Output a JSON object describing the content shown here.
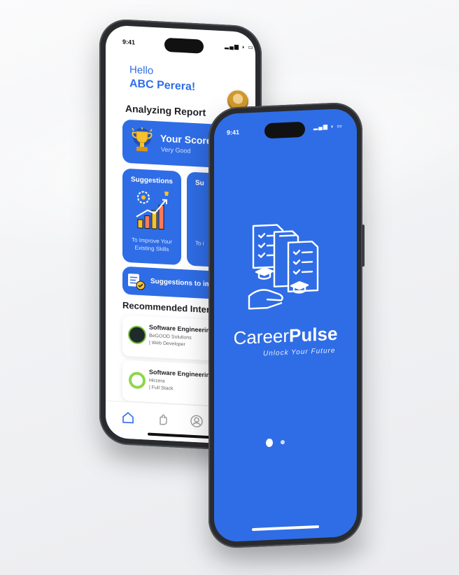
{
  "back_phone": {
    "status_time": "9:41",
    "greeting": "Hello",
    "user_name": "ABC Perera!",
    "section_analyzing": "Analyzing Report",
    "score_card": {
      "title": "Your Score is",
      "subtitle": "Very Good"
    },
    "suggestion_cards": [
      {
        "title": "Suggestions",
        "text": "To Improve Your Existing Skills"
      },
      {
        "title": "Su",
        "text": "To i"
      }
    ],
    "improve_banner": "Suggestions to imp",
    "section_recommended": "Recommended Intern",
    "internships": [
      {
        "title": "Software Engineering",
        "company": "BeGOOD Solutions",
        "role": "| Web Developer"
      },
      {
        "title": "Software Engineering",
        "company": "Hirzera",
        "role": "| Full Stack"
      }
    ],
    "tabs": [
      "home-icon",
      "hand-icon",
      "profile-icon"
    ]
  },
  "front_phone": {
    "status_time": "9:41",
    "brand_light": "Career",
    "brand_bold": "Pulse",
    "tagline": "Unlock Your Future"
  },
  "colors": {
    "primary": "#2f6de6",
    "frame": "#2a2b2e",
    "background": "#f1f2f4"
  }
}
